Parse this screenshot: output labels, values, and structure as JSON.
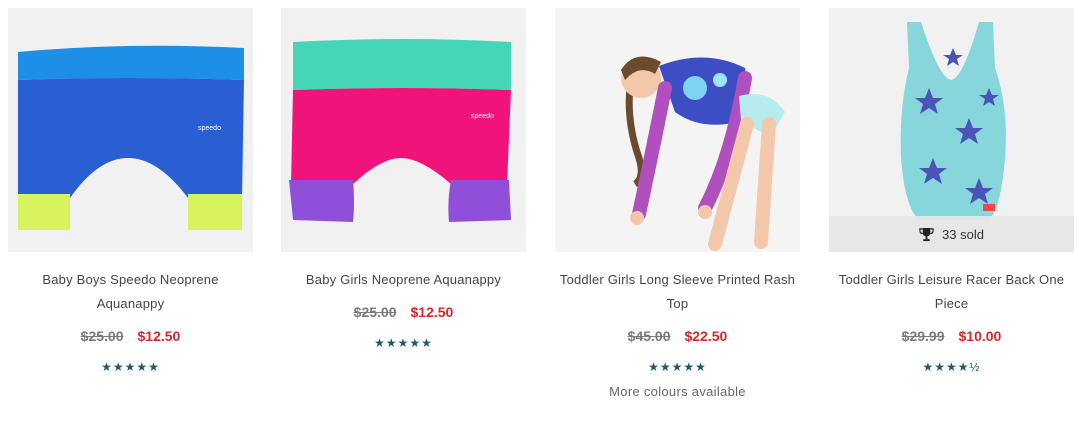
{
  "products": [
    {
      "title": "Baby Boys Speedo Neoprene Aquanappy",
      "was_price": "$25.00",
      "price": "$12.50",
      "rating_stars": "★★★★★",
      "rating": 5,
      "image_icon": "blue-swim-shorts-image"
    },
    {
      "title": "Baby Girls Neoprene Aquanappy",
      "was_price": "$25.00",
      "price": "$12.50",
      "rating_stars": "★★★★★",
      "rating": 5,
      "image_icon": "pink-swim-shorts-image"
    },
    {
      "title": "Toddler Girls Long Sleeve Printed Rash Top",
      "was_price": "$45.00",
      "price": "$22.50",
      "rating_stars": "★★★★★",
      "rating": 5,
      "more_colours": "More colours available",
      "image_icon": "girl-rash-top-photo"
    },
    {
      "title": "Toddler Girls Leisure Racer Back One Piece",
      "was_price": "$29.99",
      "price": "$10.00",
      "rating_stars": "★★★★½",
      "rating": 4.5,
      "sold_badge": "33 sold",
      "image_icon": "starfish-swimsuit-image"
    }
  ],
  "colors": {
    "sale_price": "#d9262e",
    "stars": "#1b5b6b",
    "image_bg": "#f1f1f1"
  }
}
